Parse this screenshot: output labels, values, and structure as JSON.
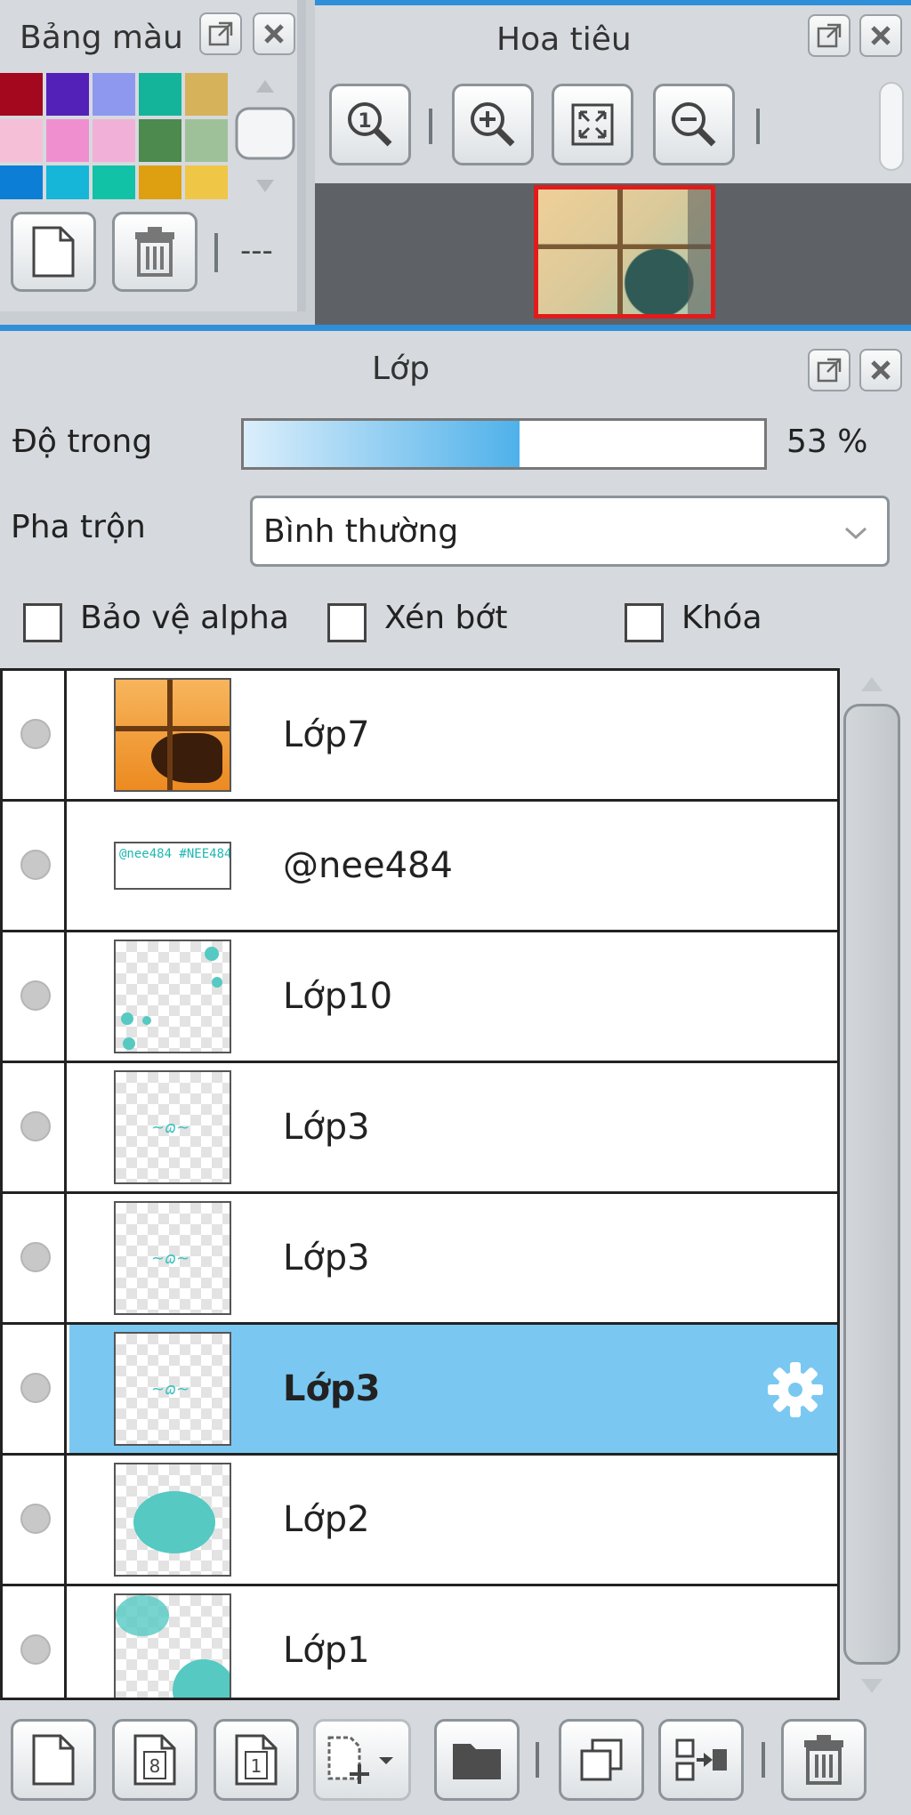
{
  "swatch_panel": {
    "title": "Bảng màu",
    "colors": [
      "#a4081e",
      "#5320b8",
      "#8e98ef",
      "#13b49a",
      "#d6b25a",
      "#f5bfd7",
      "#f08fd0",
      "#f1b0d7",
      "#4c8a4e",
      "#9ec19a",
      "#0c7ed5",
      "#15b6d8",
      "#12c2a6",
      "#dea010",
      "#f0c646"
    ],
    "more_label": "---"
  },
  "navigator": {
    "title": "Hoa tiêu"
  },
  "layers_panel": {
    "title": "Lớp",
    "opacity_label": "Độ trong",
    "opacity_value": "53 %",
    "opacity_fraction": 0.53,
    "blend_label": "Pha trộn",
    "blend_value": "Bình thường",
    "protect_alpha_label": "Bảo vệ alpha",
    "clip_label": "Xén bớt",
    "lock_label": "Khóa",
    "layers": [
      {
        "name": "Lớp7"
      },
      {
        "name": "@nee484",
        "thumb_text": "@nee484 #NEE484"
      },
      {
        "name": "Lớp10"
      },
      {
        "name": "Lớp3"
      },
      {
        "name": "Lớp3"
      },
      {
        "name": "Lớp3",
        "selected": true
      },
      {
        "name": "Lớp2"
      },
      {
        "name": "Lớp1"
      }
    ]
  }
}
